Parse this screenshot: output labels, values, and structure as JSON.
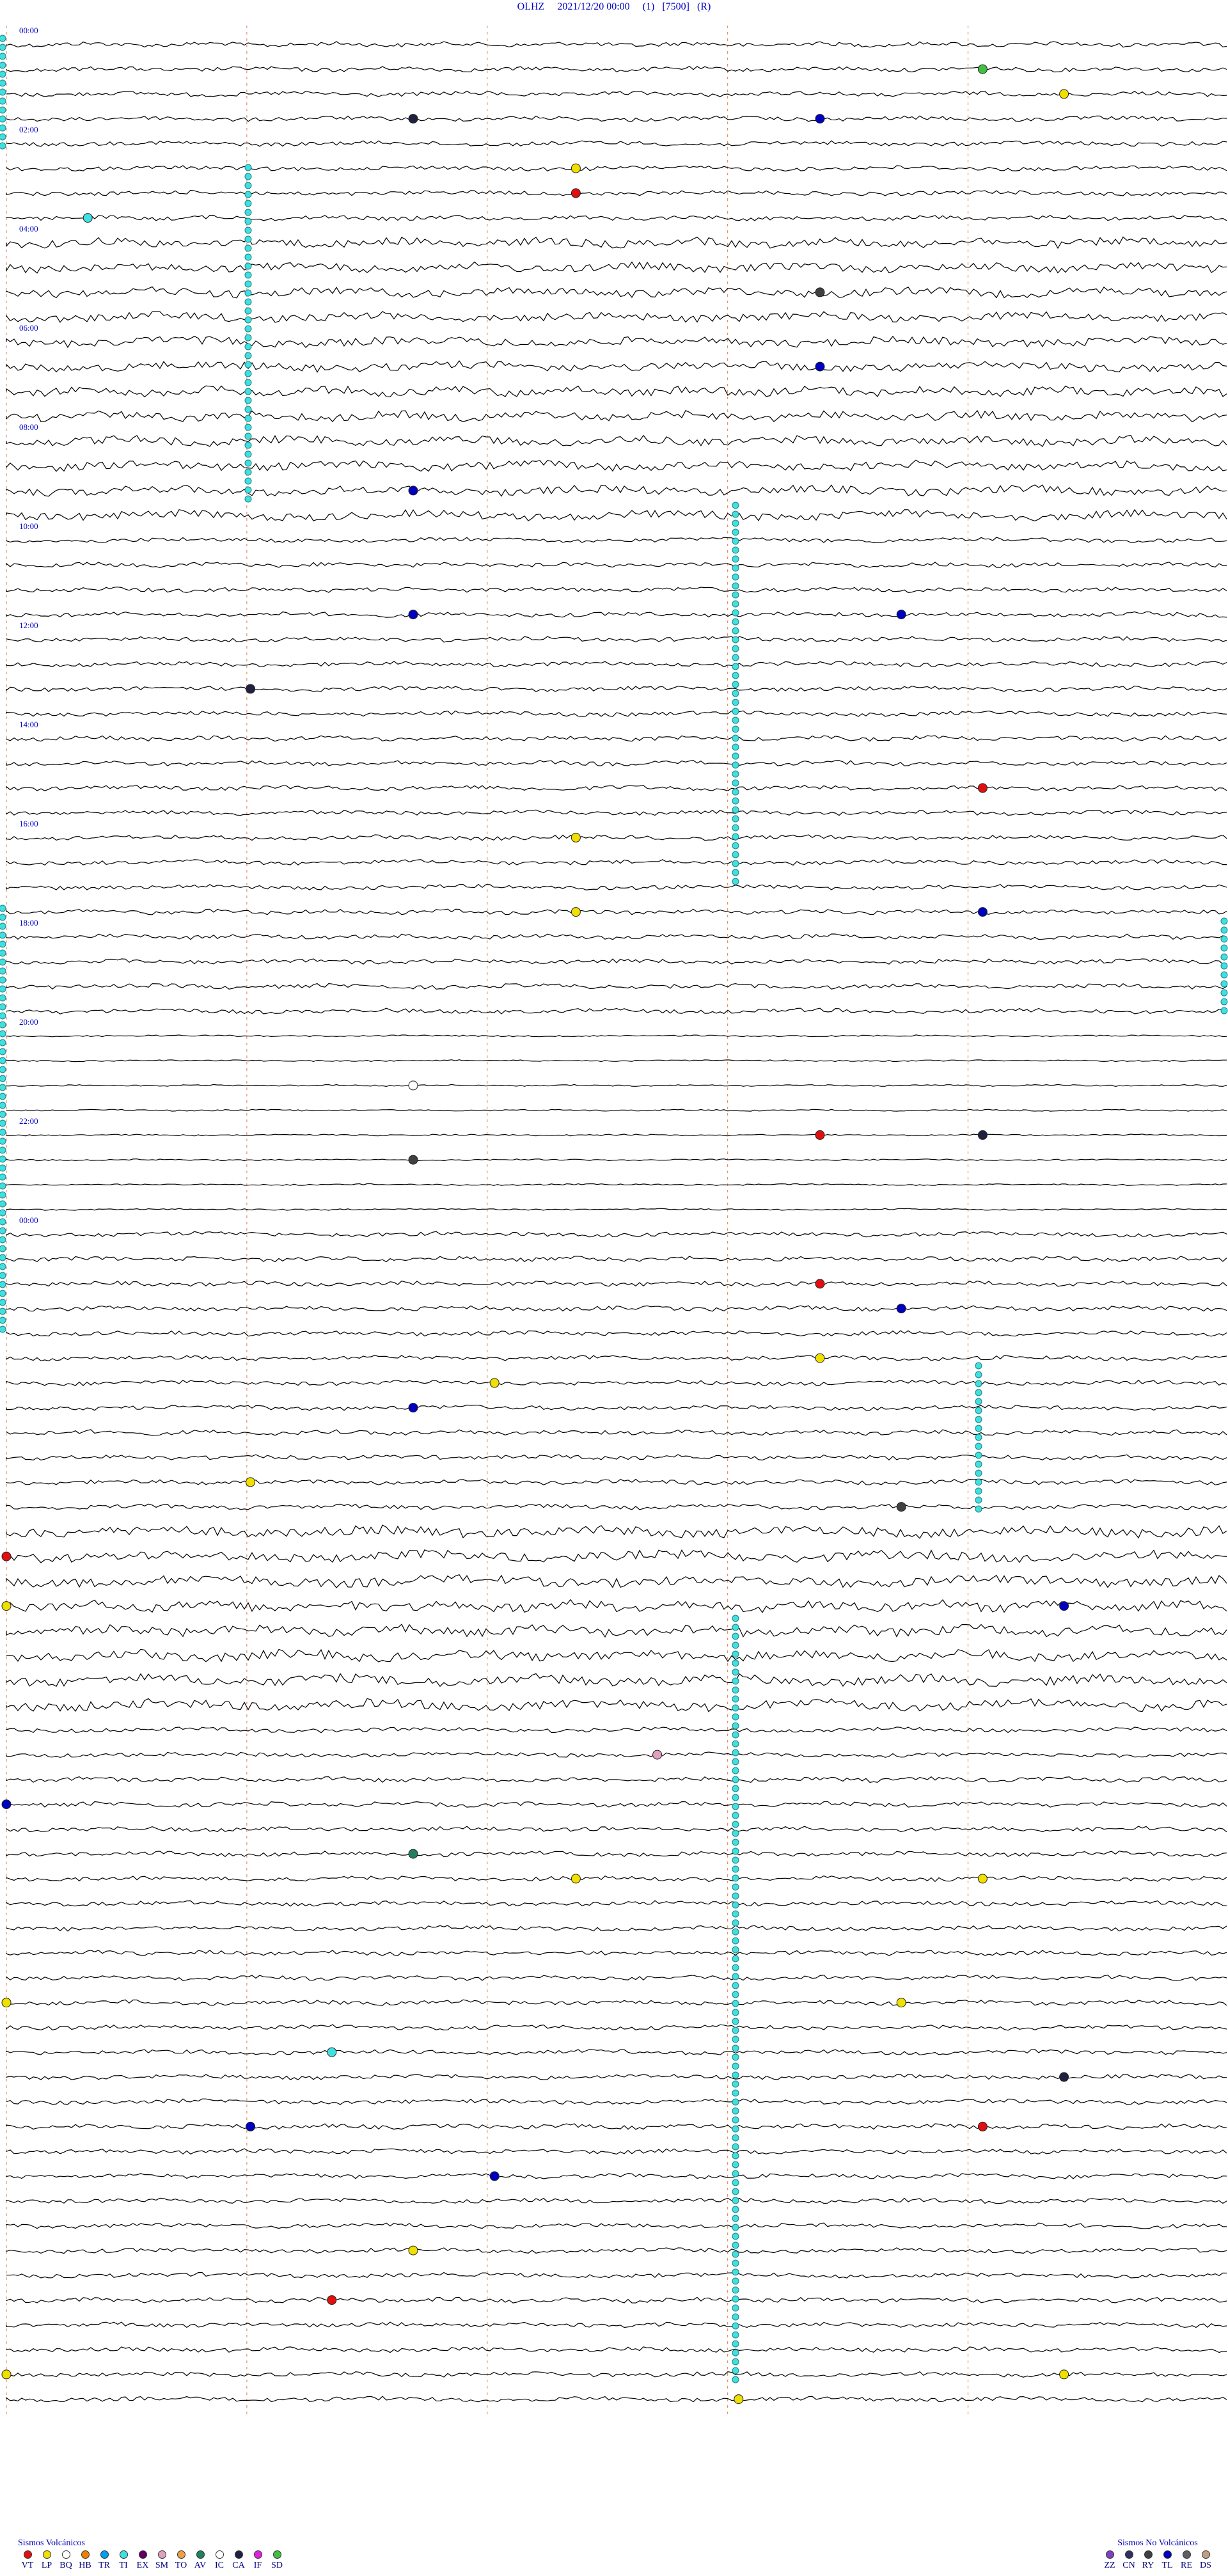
{
  "header": {
    "station": "OLHZ",
    "datetime": "2021/12/20 00:00",
    "channel": "(1)",
    "scale": "[7500]",
    "mode": "(R)"
  },
  "chart_data": {
    "type": "helicorder",
    "start": "2021/12/20 00:00",
    "end": "2021/12/21 00:00",
    "hour_labels": [
      "00:00",
      "02:00",
      "04:00",
      "06:00",
      "08:00",
      "10:00",
      "12:00",
      "14:00",
      "16:00",
      "18:00",
      "20:00",
      "22:00",
      "00:00"
    ],
    "minute_markers_min": [
      0,
      15,
      30,
      45,
      60
    ],
    "line_minutes": 15,
    "colors": {
      "label": "#0000c8",
      "minute_marker": "#e89060",
      "trace": "#000000",
      "saturation": "#40e0e0"
    },
    "events": [
      {
        "t": "00:27",
        "type": "SD"
      },
      {
        "t": "00:43",
        "type": "LP"
      },
      {
        "t": "00:50",
        "type": "CA"
      },
      {
        "t": "00:55",
        "type": "TL"
      },
      {
        "t": "01:37",
        "type": "VT"
      },
      {
        "t": "01:22",
        "type": "LP"
      },
      {
        "t": "01:46",
        "type": "TI"
      },
      {
        "t": "02:40",
        "type": "RY"
      },
      {
        "t": "03:25",
        "type": "TL"
      },
      {
        "t": "04:35",
        "type": "TL"
      },
      {
        "t": "05:56",
        "type": "TL"
      },
      {
        "t": "05:50",
        "type": "TL"
      },
      {
        "t": "06:33",
        "type": "CA"
      },
      {
        "t": "07:42",
        "type": "VT"
      },
      {
        "t": "08:07",
        "type": "LP"
      },
      {
        "t": "08:52",
        "type": "LP"
      },
      {
        "t": "08:57",
        "type": "TL"
      },
      {
        "t": "10:35",
        "type": "IC"
      },
      {
        "t": "11:10",
        "type": "VT"
      },
      {
        "t": "11:12",
        "type": "CA"
      },
      {
        "t": "11:20",
        "type": "RY"
      },
      {
        "t": "12:40",
        "type": "VT"
      },
      {
        "t": "12:56",
        "type": "TL"
      },
      {
        "t": "13:25",
        "type": "LP"
      },
      {
        "t": "13:36",
        "type": "LP"
      },
      {
        "t": "13:50",
        "type": "TL"
      },
      {
        "t": "14:33",
        "type": "LP"
      },
      {
        "t": "14:56",
        "type": "RY"
      },
      {
        "t": "15:15",
        "type": "VT"
      },
      {
        "t": "15:45",
        "type": "LP"
      },
      {
        "t": "15:58",
        "type": "TL"
      },
      {
        "t": "17:23",
        "type": "SM"
      },
      {
        "t": "17:45",
        "type": "TL"
      },
      {
        "t": "18:20",
        "type": "AV"
      },
      {
        "t": "18:37",
        "type": "LP"
      },
      {
        "t": "18:42",
        "type": "LP"
      },
      {
        "t": "19:45",
        "type": "LP"
      },
      {
        "t": "19:56",
        "type": "LP"
      },
      {
        "t": "20:19",
        "type": "TI"
      },
      {
        "t": "20:43",
        "type": "CA"
      },
      {
        "t": "21:03",
        "type": "TL"
      },
      {
        "t": "21:12",
        "type": "VT"
      },
      {
        "t": "21:36",
        "type": "TL"
      },
      {
        "t": "22:20",
        "type": "LP"
      },
      {
        "t": "22:49",
        "type": "VT"
      },
      {
        "t": "23:30",
        "type": "LP"
      },
      {
        "t": "23:43",
        "type": "LP"
      },
      {
        "t": "23:54",
        "type": "LP"
      }
    ]
  },
  "legend": {
    "volcanic_title": "Sismos Volcánicos",
    "volcanic": [
      {
        "code": "VT",
        "color": "#e01010"
      },
      {
        "code": "LP",
        "color": "#f0e000"
      },
      {
        "code": "BQ",
        "color": "#ffffff"
      },
      {
        "code": "HB",
        "color": "#f08000"
      },
      {
        "code": "TR",
        "color": "#00a0f0"
      },
      {
        "code": "TI",
        "color": "#40e0e0"
      },
      {
        "code": "EX",
        "color": "#600060"
      },
      {
        "code": "SM",
        "color": "#e0a0c0"
      },
      {
        "code": "TO",
        "color": "#f0a040"
      },
      {
        "code": "AV",
        "color": "#208060"
      },
      {
        "code": "IC",
        "color": "#ffffff"
      },
      {
        "code": "CA",
        "color": "#202040"
      },
      {
        "code": "IF",
        "color": "#e020e0"
      },
      {
        "code": "SD",
        "color": "#40c040"
      }
    ],
    "nonvolcanic_title": "Sismos No Volcánicos",
    "nonvolcanic": [
      {
        "code": "ZZ",
        "color": "#8040c0"
      },
      {
        "code": "CN",
        "color": "#303060"
      },
      {
        "code": "RY",
        "color": "#404040"
      },
      {
        "code": "TL",
        "color": "#0000c0"
      },
      {
        "code": "RE",
        "color": "#606060"
      },
      {
        "code": "DS",
        "color": "#c0a080"
      }
    ]
  }
}
